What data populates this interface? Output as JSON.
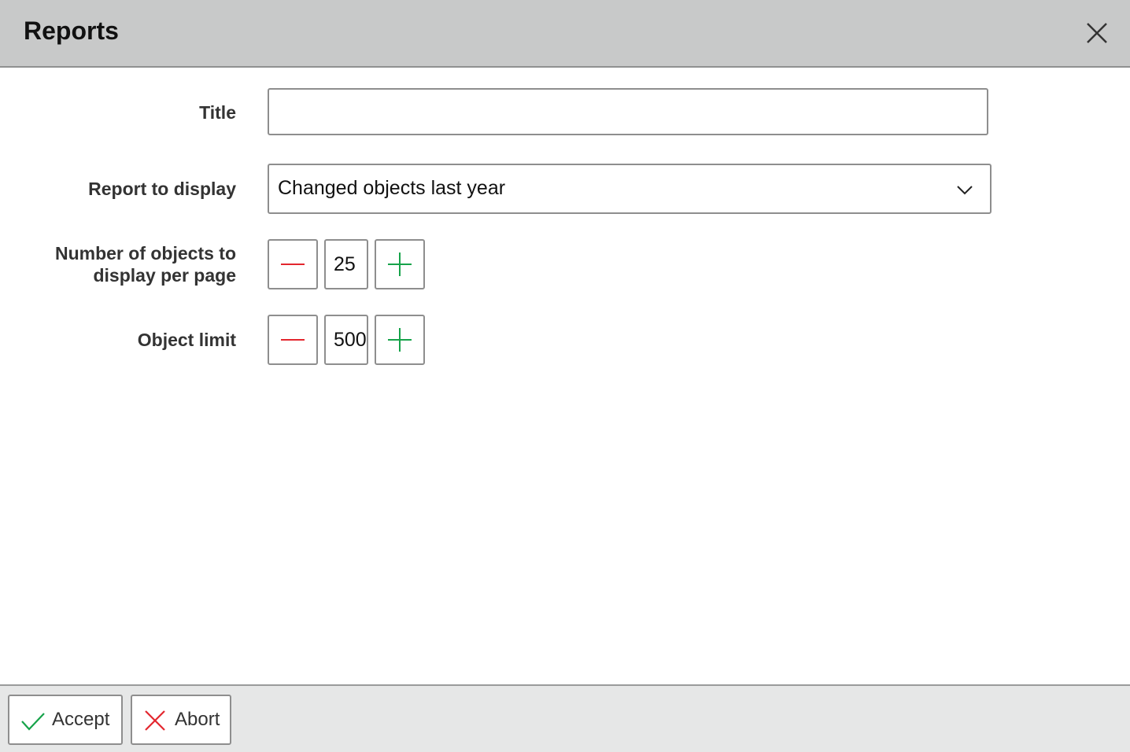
{
  "dialog": {
    "title": "Reports",
    "close_icon": "close-icon"
  },
  "form": {
    "title_field": {
      "label": "Title",
      "value": "",
      "placeholder": ""
    },
    "report_select": {
      "label": "Report to display",
      "selected": "Changed objects last year",
      "icon": "chevron-down-icon"
    },
    "objects_per_page": {
      "label_line1": "Number of objects to",
      "label_line2": "display per page",
      "value": "25",
      "decrement_icon": "minus-icon",
      "increment_icon": "plus-icon"
    },
    "object_limit": {
      "label": "Object limit",
      "value": "500",
      "decrement_icon": "minus-icon",
      "increment_icon": "plus-icon"
    }
  },
  "footer": {
    "accept_label": "Accept",
    "accept_icon": "checkmark-icon",
    "abort_label": "Abort",
    "abort_icon": "x-icon"
  },
  "colors": {
    "header_bg": "#c8c9c9",
    "footer_bg": "#e6e7e7",
    "minus": "#e3262e",
    "plus": "#16a34a",
    "accept": "#16a34a",
    "abort": "#e3262e"
  }
}
